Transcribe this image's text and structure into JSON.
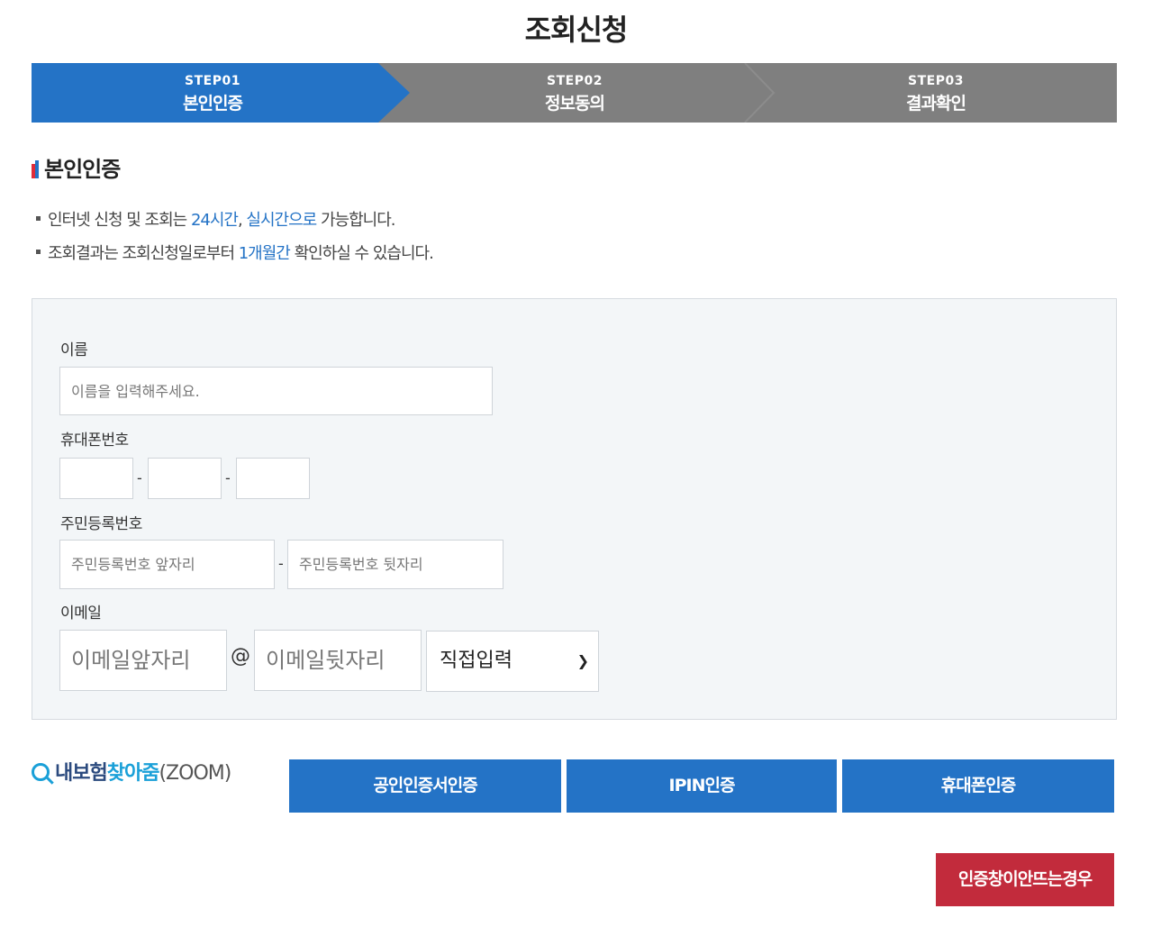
{
  "page_title": "조회신청",
  "steps": [
    {
      "num": "STEP01",
      "name": "본인인증",
      "active": true
    },
    {
      "num": "STEP02",
      "name": "정보동의",
      "active": false
    },
    {
      "num": "STEP03",
      "name": "결과확인",
      "active": false
    }
  ],
  "section_heading": "본인인증",
  "notices": [
    {
      "before": "인터넷 신청 및 조회는 ",
      "highlight1": "24시간",
      "middle": ", ",
      "highlight2": "실시간으로",
      "after": " 가능합니다."
    },
    {
      "before": "조회결과는 조회신청일로부터 ",
      "highlight1": "1개월간",
      "after": " 확인하실 수 있습니다."
    }
  ],
  "form": {
    "name_label": "이름",
    "name_placeholder": "이름을 입력해주세요.",
    "phone_label": "휴대폰번호",
    "phone_separator": "-",
    "rrn_label": "주민등록번호",
    "rrn_front_placeholder": "주민등록번호 앞자리",
    "rrn_back_placeholder": "주민등록번호 뒷자리",
    "rrn_separator": "-",
    "email_label": "이메일",
    "email_front_placeholder": "이메일앞자리",
    "email_at": "@",
    "email_back_placeholder": "이메일뒷자리",
    "email_domain_selected": "직접입력"
  },
  "zoom_link": {
    "part1": "내보험",
    "part2": "찾아줌",
    "part3": "(ZOOM)"
  },
  "auth_buttons": [
    "공인인증서인증",
    "IPIN인증",
    "휴대폰인증"
  ],
  "popup_help_button": "인증창이안뜨는경우",
  "colors": {
    "primary": "#2473c6",
    "step_inactive": "#7f7f7f",
    "danger": "#c22b3c",
    "form_bg": "#f3f6f8"
  }
}
